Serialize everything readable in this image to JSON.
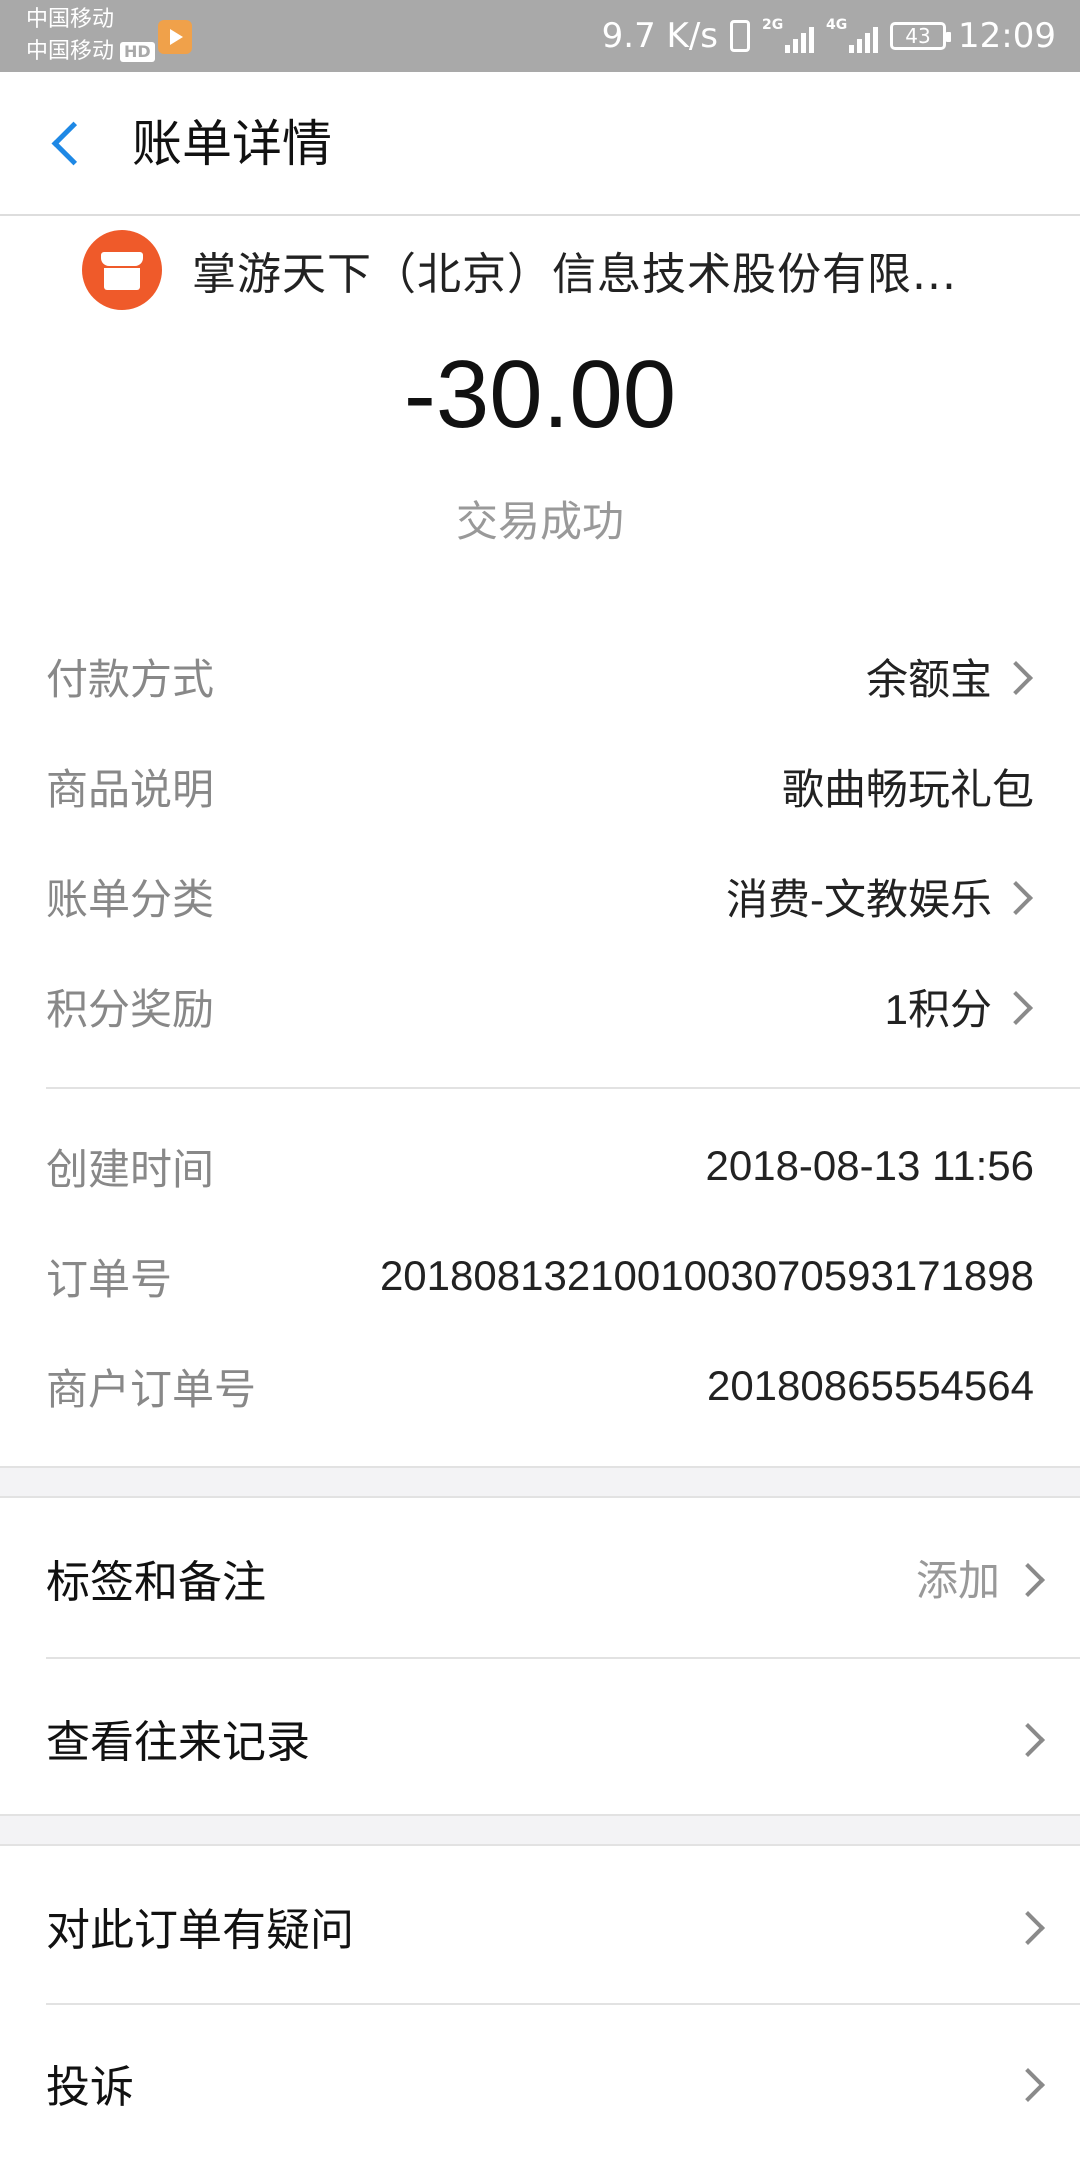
{
  "status_bar": {
    "carrier1": "中国移动",
    "carrier2": "中国移动",
    "hd": "HD",
    "net_speed": "9.7 K/s",
    "net1": "2G",
    "net2": "4G",
    "battery": "43",
    "time": "12:09"
  },
  "header": {
    "title": "账单详情"
  },
  "merchant": {
    "name": "掌游天下（北京）信息技术股份有限..."
  },
  "amount": "-30.00",
  "trade_status": "交易成功",
  "details": {
    "payment": {
      "label": "付款方式",
      "value": "余额宝"
    },
    "product": {
      "label": "商品说明",
      "value": "歌曲畅玩礼包"
    },
    "category": {
      "label": "账单分类",
      "value": "消费-文教娱乐"
    },
    "points": {
      "label": "积分奖励",
      "value": "1积分"
    },
    "created": {
      "label": "创建时间",
      "value": "2018-08-13 11:56"
    },
    "order_no": {
      "label": "订单号",
      "value": "2018081321001003070593171898"
    },
    "merchant_order_no": {
      "label": "商户订单号",
      "value": "20180865554564"
    }
  },
  "actions": {
    "tags": {
      "label": "标签和备注",
      "hint": "添加"
    },
    "history": {
      "label": "查看往来记录"
    },
    "question": {
      "label": "对此订单有疑问"
    },
    "complain": {
      "label": "投诉"
    }
  }
}
